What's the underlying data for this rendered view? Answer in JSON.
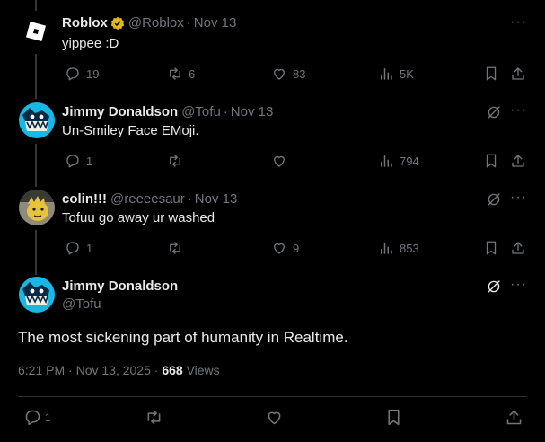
{
  "colors": {
    "background": "#000000",
    "text": "#e7e9ea",
    "muted": "#71767b",
    "gold_badge": "#e2b719"
  },
  "tweets": [
    {
      "name": "Roblox",
      "verified": "gold-verified-icon",
      "handle": "@Roblox",
      "time": "Nov 13",
      "text": "yippee :D",
      "replies": "19",
      "reposts": "6",
      "likes": "83",
      "views": "5K"
    },
    {
      "name": "Jimmy Donaldson",
      "handle": "@Tofu",
      "time": "Nov 13",
      "text": "Un-Smiley Face EMoji.",
      "replies": "1",
      "reposts": "",
      "likes": "",
      "views": "794"
    },
    {
      "name": "colin!!!",
      "handle": "@reeeesaur",
      "time": "Nov 13",
      "text": "Tofuu go away ur washed",
      "replies": "1",
      "reposts": "",
      "likes": "9",
      "views": "853"
    }
  ],
  "main": {
    "name": "Jimmy Donaldson",
    "handle": "@Tofu",
    "text": "The most sickening part of humanity in Realtime.",
    "timestamp": "6:21 PM · Nov 13, 2025",
    "views_count": "668",
    "views_label": "Views",
    "replies": "1"
  },
  "separator": "·",
  "more_glyph": "···"
}
